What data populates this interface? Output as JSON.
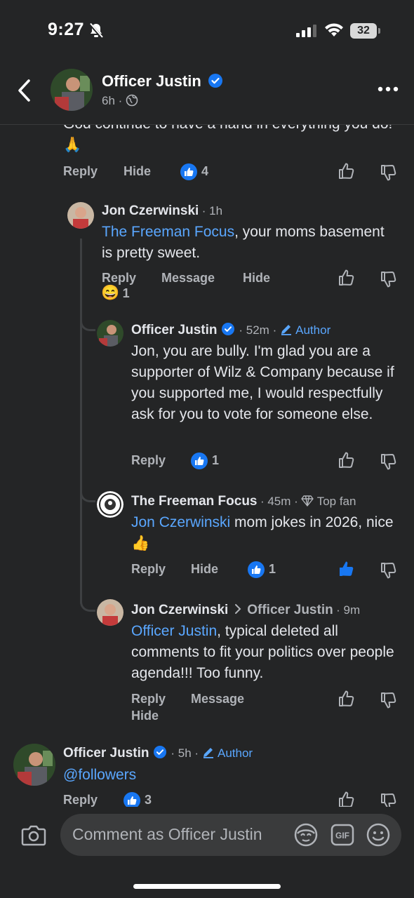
{
  "status": {
    "time": "9:27",
    "battery": "32"
  },
  "header": {
    "name": "Officer Justin",
    "time": "6h ·"
  },
  "comments": {
    "top_partial": {
      "text": "God continue to have a hand in everything you do! 🙏",
      "reply": "Reply",
      "hide": "Hide",
      "likes": "4"
    },
    "jon1": {
      "name": "Jon Czerwinski",
      "time": "· 1h",
      "mention": "The Freeman Focus",
      "text": ", your moms basement is pretty sweet.",
      "reply": "Reply",
      "message": "Message",
      "hide": "Hide",
      "reaction_emoji": "😄",
      "reaction_count": "1"
    },
    "justin1": {
      "name": "Officer Justin",
      "time": "· 52m ·",
      "author": "Author",
      "text": "Jon, you are bully. I'm glad you are a supporter of Wilz & Company because if you supported me, I would respectfully ask for you to vote for someone else.",
      "reply": "Reply",
      "likes": "1"
    },
    "freeman": {
      "name": "The Freeman Focus",
      "time": "· 45m ·",
      "badge": "Top fan",
      "mention": "Jon Czerwinski",
      "text": " mom jokes in 2026, nice 👍",
      "reply": "Reply",
      "hide": "Hide",
      "likes": "1"
    },
    "jon2": {
      "name": "Jon Czerwinski",
      "reply_to": "Officer Justin",
      "time": "· 9m",
      "mention": "Officer Justin",
      "text": ", typical deleted all comments to fit your politics over people agenda!!!  Too funny.",
      "reply": "Reply",
      "message": "Message",
      "hide": "Hide"
    },
    "justin2": {
      "name": "Officer Justin",
      "time": "· 5h ·",
      "author": "Author",
      "mention": "@followers",
      "reply": "Reply",
      "likes": "3"
    }
  },
  "composer": {
    "placeholder": "Comment as Officer Justin"
  },
  "colors": {
    "background": "#242526",
    "link": "#5aa7ff",
    "like_blue": "#1877f2"
  }
}
